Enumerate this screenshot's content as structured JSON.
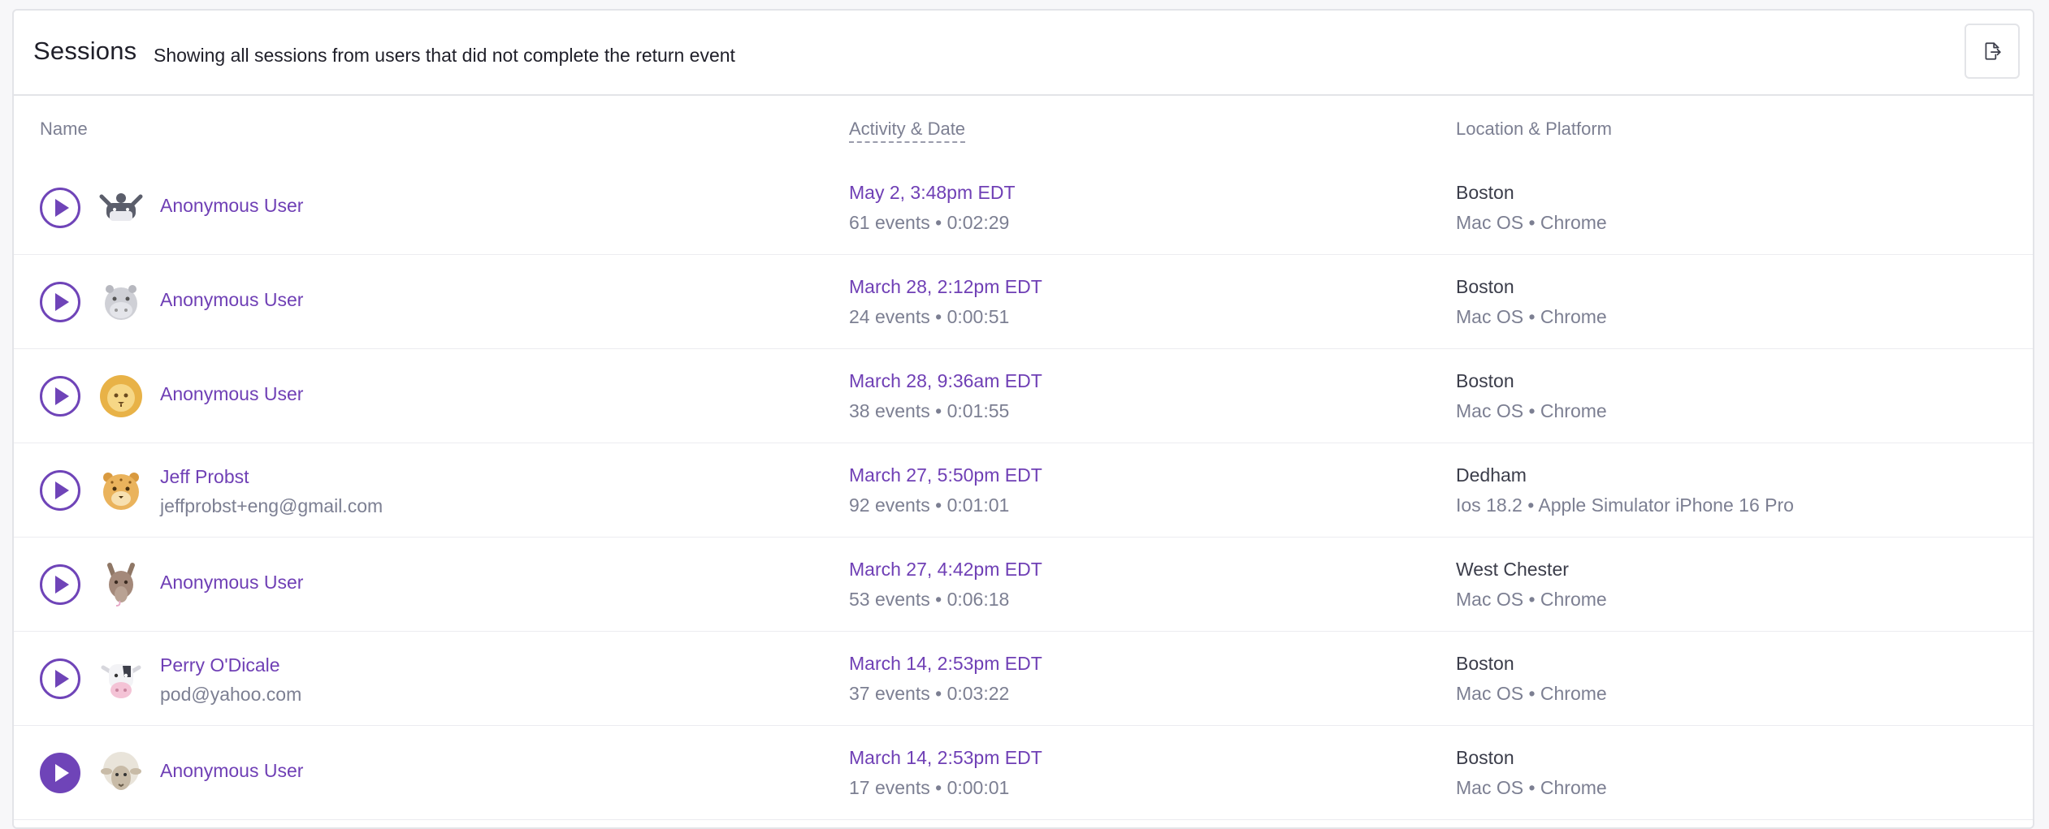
{
  "header": {
    "title": "Sessions",
    "subtitle": "Showing all sessions from users that did not complete the return event",
    "export_icon": "export-icon"
  },
  "columns": {
    "name": "Name",
    "activity": "Activity & Date",
    "location": "Location & Platform"
  },
  "colors": {
    "accent": "#6f3fb5",
    "muted": "#7c7f92",
    "border": "#e3e4e8"
  },
  "sessions": [
    {
      "avatar": "whale-icon",
      "name": "Anonymous User",
      "email": "",
      "date": "May 2, 3:48pm EDT",
      "meta": "61 events • 0:02:29",
      "city": "Boston",
      "platform": "Mac OS • Chrome"
    },
    {
      "avatar": "hippo-icon",
      "name": "Anonymous User",
      "email": "",
      "date": "March 28, 2:12pm EDT",
      "meta": "24 events • 0:00:51",
      "city": "Boston",
      "platform": "Mac OS • Chrome"
    },
    {
      "avatar": "lion-icon",
      "name": "Anonymous User",
      "email": "",
      "date": "March 28, 9:36am EDT",
      "meta": "38 events • 0:01:55",
      "city": "Boston",
      "platform": "Mac OS • Chrome"
    },
    {
      "avatar": "cheetah-icon",
      "name": "Jeff Probst",
      "email": "jeffprobst+eng@gmail.com",
      "date": "March 27, 5:50pm EDT",
      "meta": "92 events • 0:01:01",
      "city": "Dedham",
      "platform": "Ios 18.2 • Apple Simulator iPhone 16 Pro"
    },
    {
      "avatar": "kangaroo-icon",
      "name": "Anonymous User",
      "email": "",
      "date": "March 27, 4:42pm EDT",
      "meta": "53 events • 0:06:18",
      "city": "West Chester",
      "platform": "Mac OS • Chrome"
    },
    {
      "avatar": "cow-icon",
      "name": "Perry O'Dicale",
      "email": "pod@yahoo.com",
      "date": "March 14, 2:53pm EDT",
      "meta": "37 events • 0:03:22",
      "city": "Boston",
      "platform": "Mac OS • Chrome"
    },
    {
      "avatar": "sheep-icon",
      "name": "Anonymous User",
      "email": "",
      "date": "March 14, 2:53pm EDT",
      "meta": "17 events • 0:00:01",
      "city": "Boston",
      "platform": "Mac OS • Chrome"
    }
  ]
}
